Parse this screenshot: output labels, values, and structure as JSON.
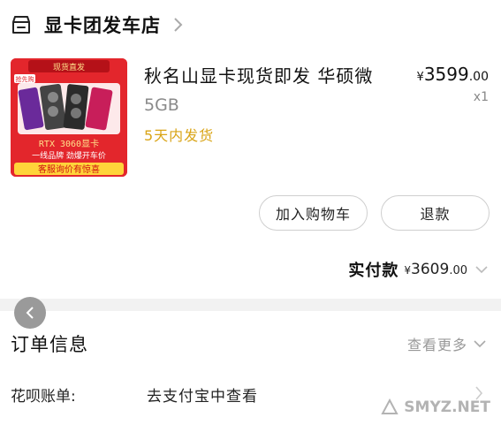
{
  "store": {
    "name": "显卡团发车店"
  },
  "product": {
    "title": "秋名山显卡现货即发 华硕微",
    "price_symbol": "¥",
    "price_int": "3599",
    "price_dec": ".00",
    "qty": "x1",
    "spec": "5GB",
    "shipping": "5天内发货",
    "image": {
      "badge_top": "现货直发",
      "badge_left": "抢先购",
      "line1": "RTX 3060显卡",
      "line2": "一线品牌 劲爆开车价",
      "line3": "客服询价有惊喜"
    }
  },
  "actions": {
    "cart_label": "加入购物车",
    "refund_label": "退款"
  },
  "paid": {
    "label": "实付款",
    "symbol": "¥",
    "int": "3609",
    "dec": ".00"
  },
  "order": {
    "title": "订单信息",
    "see_more": "查看更多",
    "rows": [
      {
        "label": "花呗账单:",
        "value": "去支付宝中查看"
      }
    ]
  },
  "watermark": {
    "text": "SMYZ.NET"
  },
  "colors": {
    "accent_gold": "#d9a416",
    "image_red": "#e3262c"
  },
  "icons": [
    "store-icon",
    "chevron-right-icon",
    "chevron-down-icon",
    "back-arrow-icon",
    "watermark-logo-icon"
  ]
}
